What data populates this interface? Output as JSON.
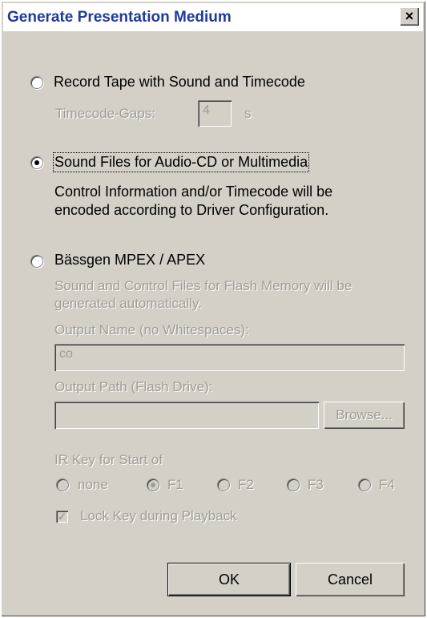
{
  "window": {
    "title": "Generate Presentation Medium",
    "close_glyph": "×"
  },
  "option_tape": {
    "label": "Record Tape with Sound and Timecode",
    "selected": false,
    "gaps_label": "Timecode-Gaps:",
    "gaps_value": "4",
    "gaps_unit": "s"
  },
  "option_soundfiles": {
    "label": "Sound Files for Audio-CD or Multimedia",
    "selected": true,
    "description_line1": "Control Information and/or Timecode will be",
    "description_line2": "encoded according to Driver Configuration."
  },
  "option_mpex": {
    "label": "Bässgen MPEX / APEX",
    "selected": false,
    "description_line1": "Sound and Control Files for Flash Memory will be",
    "description_line2": "generated automatically.",
    "output_name_label": "Output Name (no Whitespaces):",
    "output_name_value": "co",
    "output_path_label": "Output Path (Flash Drive):",
    "output_path_value": "",
    "browse_label": "Browse...",
    "ir_key_label": "IR Key for Start of",
    "ir_keys": [
      {
        "label": "none",
        "selected": false
      },
      {
        "label": "F1",
        "selected": true
      },
      {
        "label": "F2",
        "selected": false
      },
      {
        "label": "F3",
        "selected": false
      },
      {
        "label": "F4",
        "selected": false
      }
    ],
    "lock_key_label": "Lock Key during Playback",
    "lock_key_checked": true,
    "check_glyph": "✓"
  },
  "buttons": {
    "ok_label": "OK",
    "cancel_label": "Cancel"
  }
}
